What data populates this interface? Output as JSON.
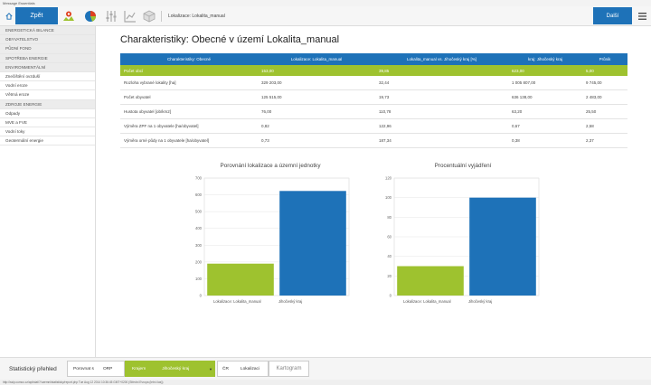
{
  "window": {
    "title": "Message Essentials"
  },
  "topbar": {
    "back_label": "Zpět",
    "breadcrumb": "Lokalizace: Lokalita_manual",
    "next_label": "Další"
  },
  "sidebar": {
    "items": [
      {
        "label": "ENERGETICKÁ BILANCE",
        "category": true
      },
      {
        "label": "OBYVATELSTVO",
        "category": true
      },
      {
        "label": "PŮDNÍ FOND",
        "category": true
      },
      {
        "label": "SPOTŘEBA ENERGIE",
        "category": true
      },
      {
        "label": "ENVIRONMENTÁLNÍ",
        "category": true
      },
      {
        "label": "Znečištění ovzduší",
        "category": false
      },
      {
        "label": "Vodní eroze",
        "category": false
      },
      {
        "label": "Větrná eroze",
        "category": false
      },
      {
        "label": "ZDROJE ENERGIE",
        "category": true
      },
      {
        "label": "Odpady",
        "category": false
      },
      {
        "label": "MVE a FVE",
        "category": false
      },
      {
        "label": "Vodní toky",
        "category": false
      },
      {
        "label": "Geotermální energie",
        "category": false
      }
    ]
  },
  "main": {
    "title": "Charakteristiky: Obecné v území Lokalita_manual",
    "table": {
      "headers": [
        "Charakteristiky: Obecné",
        "Lokalizace: Lokalita_manual",
        "Lokalita_manual vs. Jihočeský kraj [%]",
        "kraj: Jihočeský kraj",
        "Průnik"
      ],
      "rows": [
        [
          "Počet obcí",
          "153,00",
          "39,85",
          "623,00",
          "5,00"
        ],
        [
          "Rozloha vybrané lokality [ha]",
          "329 203,00",
          "32,44",
          "1 005 807,00",
          "9 745,00"
        ],
        [
          "Počet obyvatel",
          "125 515,00",
          "19,73",
          "636 138,00",
          "2 483,00"
        ],
        [
          "Hustota obyvatel [ob/km2]",
          "76,00",
          "110,78",
          "63,20",
          "25,50"
        ],
        [
          "Výměra ZPF na 1 obyvatele [ha/obyvatel]",
          "0,82",
          "122,96",
          "0,67",
          "2,58"
        ],
        [
          "Výměra orné půdy na 1 obyvatele [ha/obyvatel]",
          "0,73",
          "187,34",
          "0,38",
          "2,37"
        ]
      ]
    }
  },
  "charts": {
    "colors": {
      "green": "#9ec22f",
      "blue": "#1e72b8",
      "accent": "#1e72b8"
    }
  },
  "chart_data": [
    {
      "type": "bar",
      "title": "Porovnání lokalizace a územní jednotky",
      "categories": [
        "Lokalizace: Lokalita_manual",
        "Jihočeský kraj"
      ],
      "values": [
        190,
        623
      ],
      "ylim": [
        0,
        700
      ],
      "yticks": [
        "0",
        "100",
        "200",
        "300",
        "400",
        "500",
        "600",
        "700"
      ],
      "grid": true
    },
    {
      "type": "bar",
      "title": "Procentuální vyjádření",
      "categories": [
        "Lokalizace: Lokalita_manual",
        "Jihočeský kraj"
      ],
      "values": [
        30,
        100
      ],
      "ylim": [
        0,
        120
      ],
      "yticks": [
        "0",
        "20",
        "40",
        "60",
        "80",
        "100",
        "120"
      ],
      "grid": true
    }
  ],
  "bottombar": {
    "stat_label": "Statistický přehled",
    "compare_label": "Porovnat s",
    "compare_value": "ORP",
    "region_label": "Krajem",
    "region_value": "Jihočeský kraj",
    "cr_label": "ČR",
    "localization_label": "Lokalizaci",
    "cartogram_label": "Kartogram"
  },
  "statusbar": {
    "text": "http://ssip.cumoc.cz/api/stat/?/uzemni/statisticky/report.php Tue Aug 12 2014 10:36:45 GMT+0200 (Střední Evropa (letní čas))"
  }
}
